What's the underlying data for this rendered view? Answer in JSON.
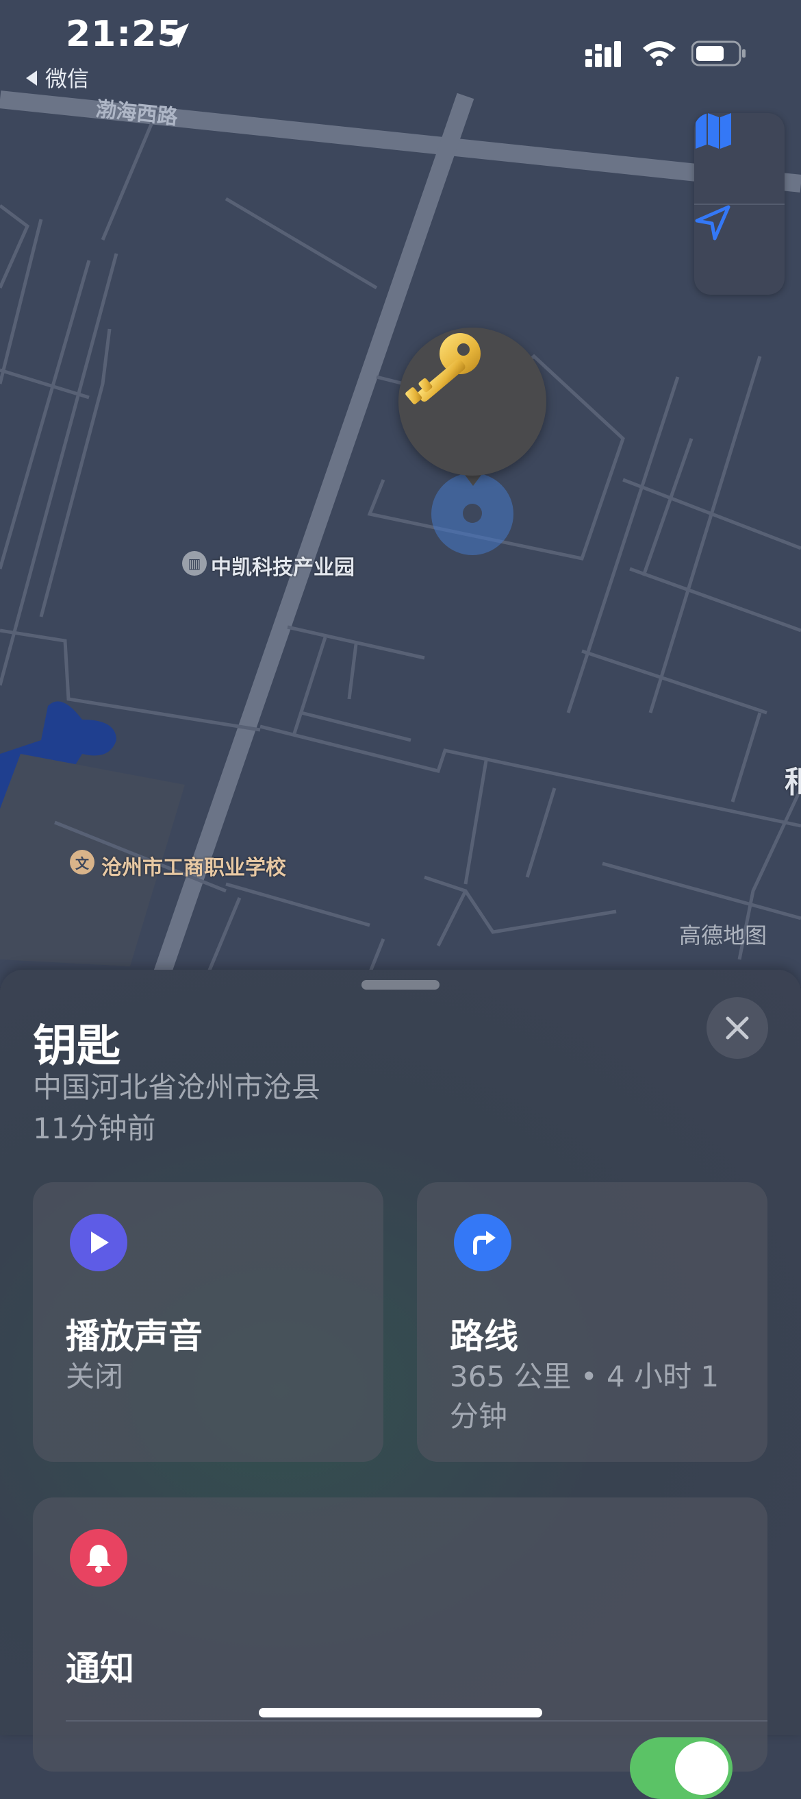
{
  "status_bar": {
    "time": "21:25",
    "back_app": "微信"
  },
  "map": {
    "road_label": "渤海西路",
    "poi_park": "中凯科技产业园",
    "poi_school": "沧州市工商职业学校",
    "partial_label_right": "秬",
    "attribution": "高德地图",
    "controls": [
      "map-mode-icon",
      "location-arrow-icon"
    ],
    "pin_icon": "key-icon",
    "colors": {
      "map_bg": "#3d475c",
      "road": "#6b7487",
      "water": "#1f3f8f",
      "accuracy": "#4678c8"
    }
  },
  "sheet": {
    "title": "钥匙",
    "address": "中国河北省沧州市沧县",
    "last_seen": "11分钟前",
    "sound_card": {
      "title": "播放声音",
      "status": "关闭",
      "icon": "play-icon",
      "color": "#5e5ce6"
    },
    "route_card": {
      "title": "路线",
      "detail": "365 公里 • 4 小时 1 分钟",
      "icon": "turn-right-arrow-icon",
      "color": "#3478f6"
    },
    "notify_card": {
      "title": "通知",
      "icon": "bell-icon",
      "color": "#e84361",
      "toggle_on": true
    }
  }
}
